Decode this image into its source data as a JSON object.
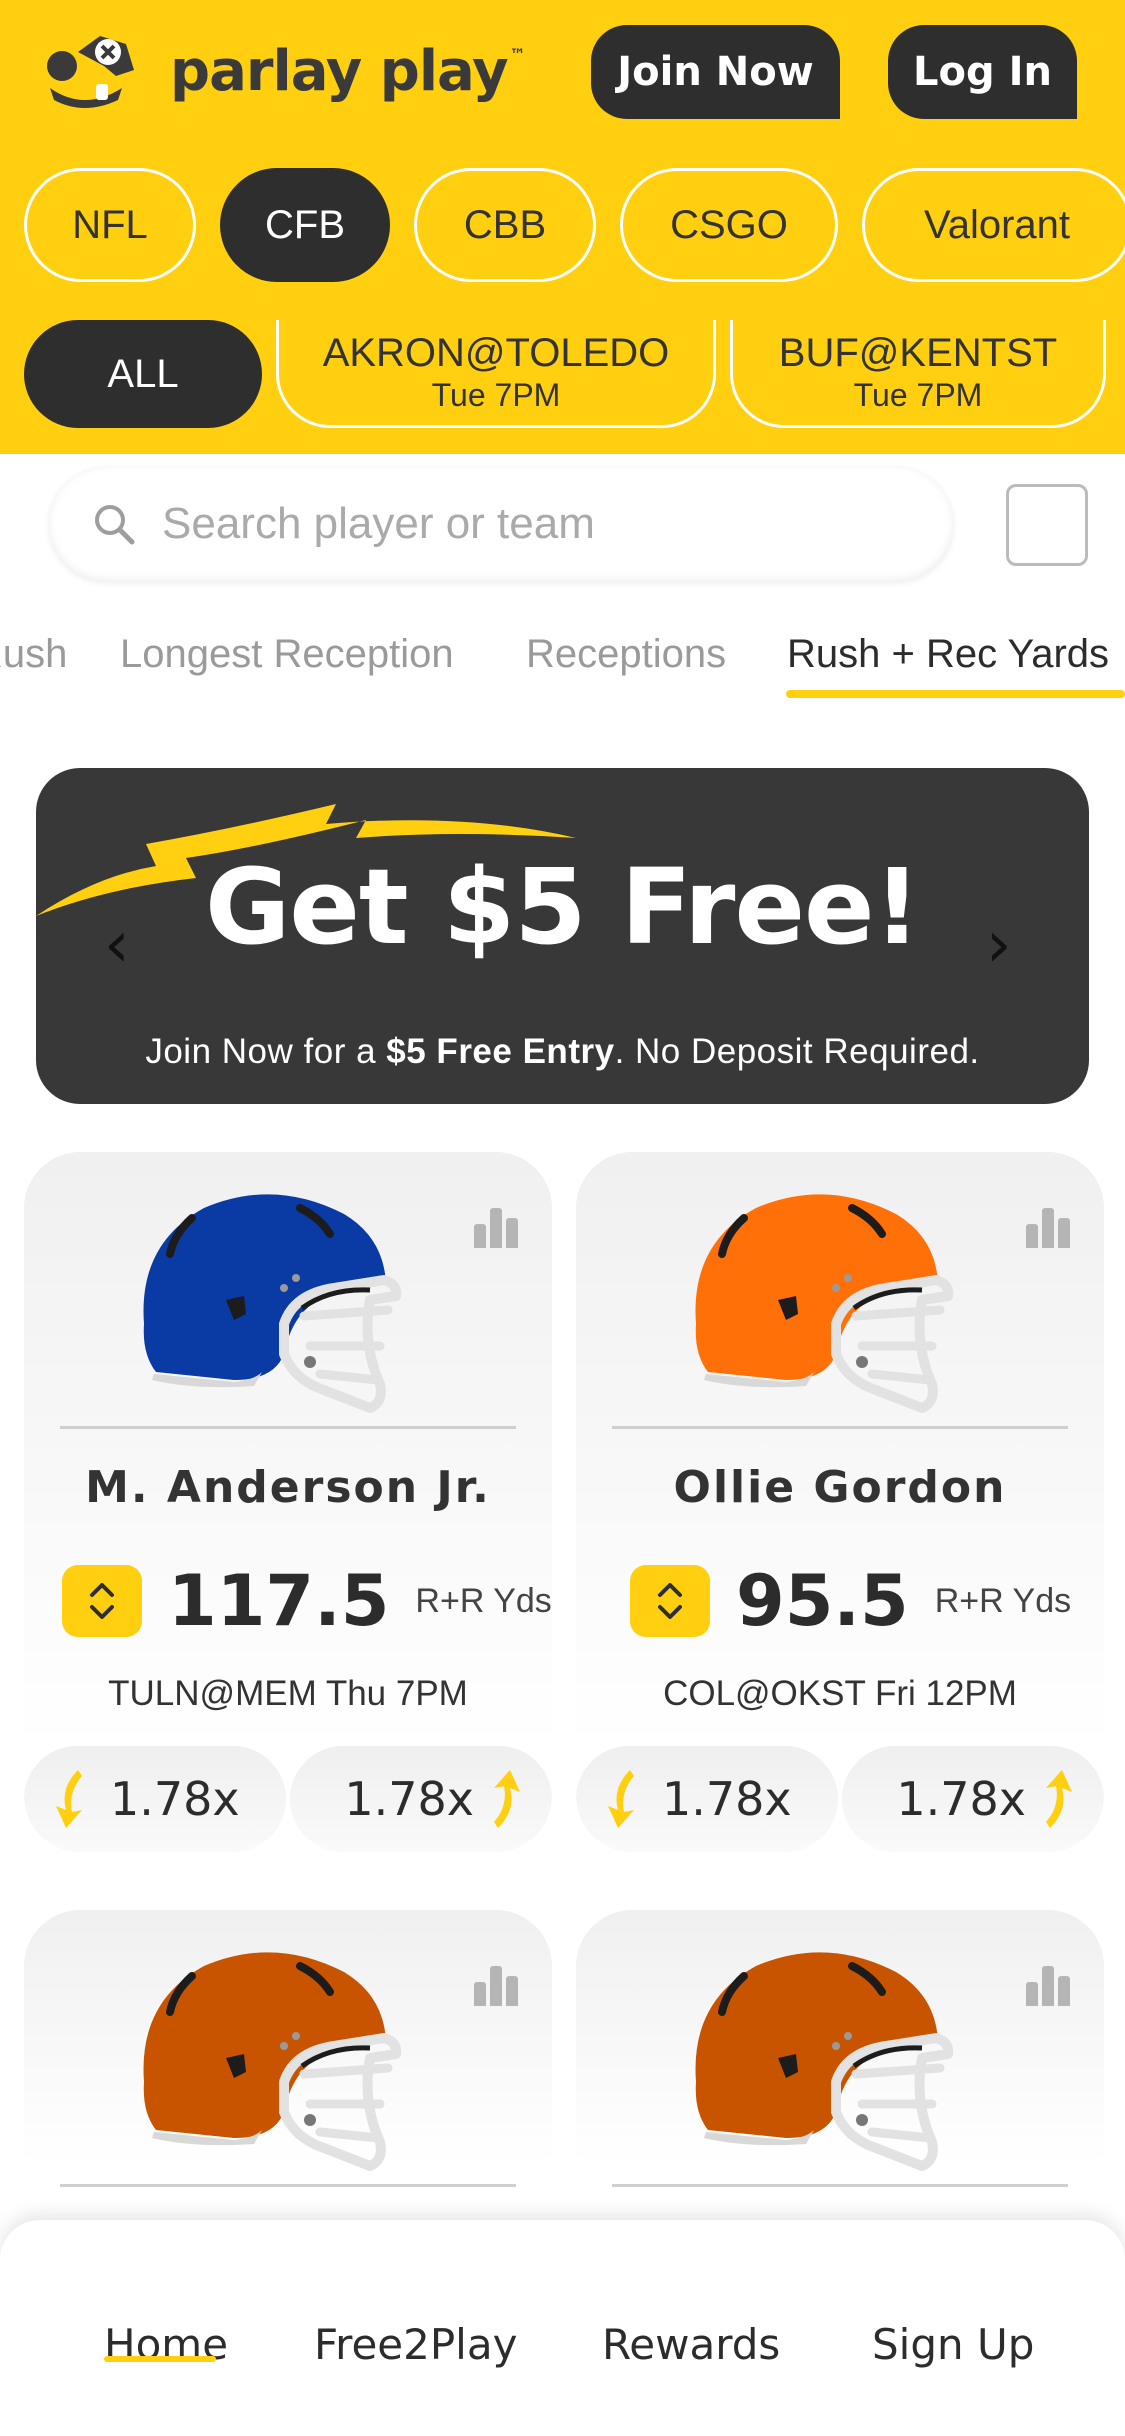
{
  "header": {
    "brand": "parlay play",
    "trademark": "™",
    "join_label": "Join Now",
    "login_label": "Log In",
    "bg_color": "#ffcf10"
  },
  "sports": [
    {
      "label": "NFL",
      "active": false
    },
    {
      "label": "CFB",
      "active": true
    },
    {
      "label": "CBB",
      "active": false
    },
    {
      "label": "CSGO",
      "active": false
    },
    {
      "label": "Valorant",
      "active": false
    }
  ],
  "games": {
    "all_label": "ALL",
    "items": [
      {
        "matchup": "AKRON@TOLEDO",
        "time": "Tue 7PM"
      },
      {
        "matchup": "BUF@KENTST",
        "time": "Tue 7PM"
      }
    ]
  },
  "search": {
    "placeholder": "Search player or team"
  },
  "stat_tabs": [
    {
      "label": "Rush",
      "active": false
    },
    {
      "label": "Longest Reception",
      "active": false
    },
    {
      "label": "Receptions",
      "active": false
    },
    {
      "label": "Rush + Rec Yards",
      "active": true
    }
  ],
  "promo": {
    "title": "Get $5 Free!",
    "sub_pre": "Join Now for a ",
    "sub_bold": "$5 Free Entry",
    "sub_post": ". No Deposit Required.",
    "prev_arrow": "‹",
    "next_arrow": "›"
  },
  "cards": [
    {
      "player": "M. Anderson Jr.",
      "line": "117.5",
      "stat": "R+R Yds",
      "matchup": "TULN@MEM Thu 7PM",
      "less_mult": "1.78x",
      "more_mult": "1.78x",
      "helmet_color": "#0a3aa3"
    },
    {
      "player": "Ollie Gordon",
      "line": "95.5",
      "stat": "R+R Yds",
      "matchup": "COL@OKST Fri 12PM",
      "less_mult": "1.78x",
      "more_mult": "1.78x",
      "helmet_color": "#ff7008"
    },
    {
      "helmet_color": "#c95400"
    },
    {
      "helmet_color": "#c95400"
    }
  ],
  "bottom_nav": [
    {
      "label": "Home",
      "active": true
    },
    {
      "label": "Free2Play",
      "active": false
    },
    {
      "label": "Rewards",
      "active": false
    },
    {
      "label": "Sign Up",
      "active": false
    }
  ]
}
